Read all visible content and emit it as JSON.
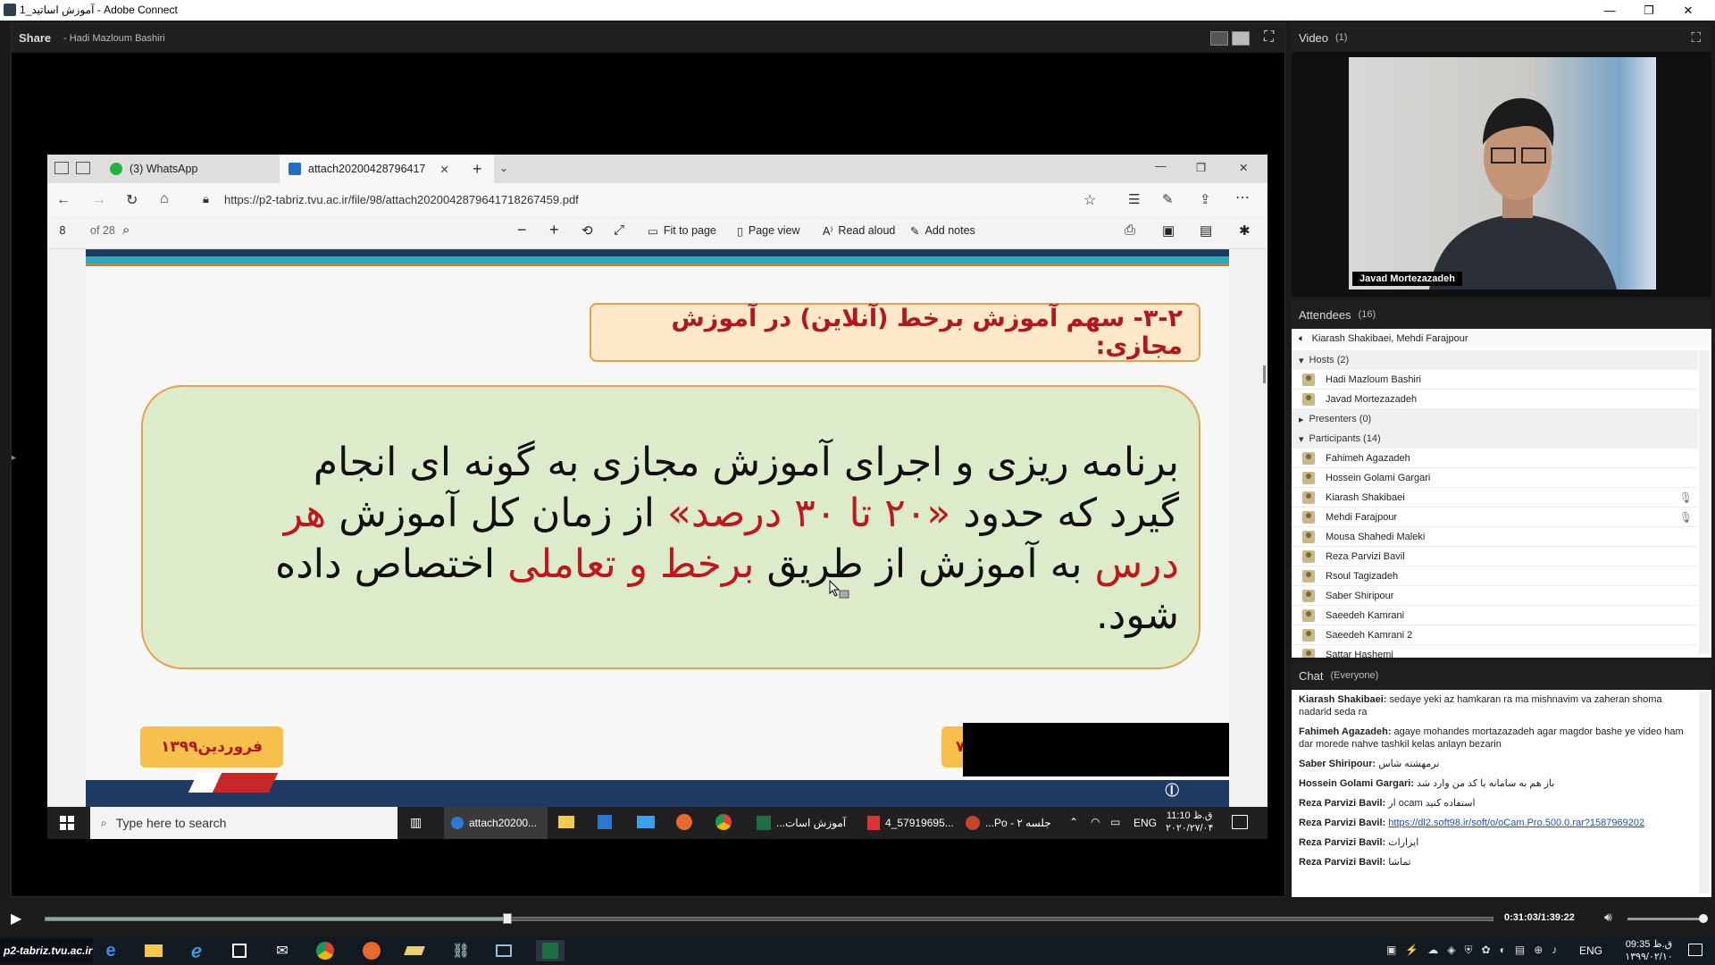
{
  "window": {
    "title": "آموزش اساتید_1 - Adobe Connect"
  },
  "share_pod": {
    "label": "Share",
    "presenter": "- Hadi Mazloum Bashiri"
  },
  "browser": {
    "tabs": [
      {
        "label": "(3) WhatsApp"
      },
      {
        "label": "attach20200428796417"
      }
    ],
    "url": "https://p2-tabriz.tvu.ac.ir/file/98/attach202004287964171826745​9.pdf",
    "pdf_toolbar": {
      "page_number": "8",
      "page_total": "of 28",
      "fit_to_page": "Fit to page",
      "page_view": "Page view",
      "read_aloud": "Read aloud",
      "add_notes": "Add notes"
    },
    "slide": {
      "heading": "۳-۲- سهم آموزش برخط (آنلاین) در آموزش مجازی:",
      "body_lines": [
        [
          {
            "t": "برنامه ریزی و اجرای آموزش مجازی به گونه ای انجام",
            "c": "#111"
          }
        ],
        [
          {
            "t": "گیرد که حدود ",
            "c": "#111"
          },
          {
            "t": "«۲۰ تا ۳۰ درصد»",
            "c": "#c0161c"
          },
          {
            "t": " از زمان کل آموزش ",
            "c": "#111"
          },
          {
            "t": "هر",
            "c": "#c0161c"
          }
        ],
        [
          {
            "t": "درس",
            "c": "#c0161c"
          },
          {
            "t": " به آموزش از طریق ",
            "c": "#111"
          },
          {
            "t": "برخط و تعاملی",
            "c": "#c0161c"
          },
          {
            "t": " اختصاص داده",
            "c": "#111"
          }
        ],
        [
          {
            "t": "شود.",
            "c": "#111"
          }
        ]
      ],
      "date_badge": "فروردین۱۳۹۹",
      "right_badge_char": "۷"
    },
    "taskbar": {
      "search_placeholder": "Type here to search",
      "items": [
        "attach20200...",
        "آموزش اسات...",
        "4_57919695...",
        "جلسه ۲ - Po..."
      ],
      "lang": "ENG",
      "time": "11:10 ق.ظ",
      "date": "۲۰۲۰/۲۷/۰۴"
    }
  },
  "video_pod": {
    "title": "Video",
    "count": "(1)",
    "name_tag": "Javad Mortezazadeh"
  },
  "attendees": {
    "title": "Attendees",
    "count": "(16)",
    "top_line": "Kiarash Shakibaei, Mehdi Farajpour",
    "hosts_label": "Hosts (2)",
    "hosts": [
      "Hadi Mazloum Bashiri",
      "Javad Mortezazadeh"
    ],
    "presenters_label": "Presenters (0)",
    "participants_label": "Participants (14)",
    "participants": [
      "Fahimeh Agazadeh",
      "Hossein Golami Gargari",
      "Kiarash Shakibaei",
      "Mehdi Farajpour",
      "Mousa Shahedi Maleki",
      "Reza Parvizi Bavil",
      "Rsoul Tagizadeh",
      "Saber Shiripour",
      "Saeedeh Kamrani",
      "Saeedeh Kamrani 2",
      "Sattar Hashemi"
    ]
  },
  "chat": {
    "title": "Chat",
    "scope": "(Everyone)",
    "messages": [
      {
        "from": "Kiarash Shakibaei:",
        "text": " sedaye yeki az hamkaran ra ma mishnavim va zaheran shoma nadarid seda ra"
      },
      {
        "from": "Fahimeh Agazadeh:",
        "text": " agaye mohandes mortazazadeh agar magdor bashe ye video ham dar morede nahve tashkil kelas anlayn bezarin"
      },
      {
        "from": "Saber Shiripour:",
        "text": " نرمهشته شاس"
      },
      {
        "from": "Hossein Golami Gargari:",
        "text": " باز هم به سامانه یا کد من وارد شد"
      },
      {
        "from": "Reza Parvizi Bavil:",
        "text": " از ocam استفاده کنید"
      },
      {
        "from": "Reza Parvizi Bavil:",
        "text": "",
        "link": "https://dl2.soft98.ir/soft/o/oCam.Pro.500.0.rar?1587969202"
      },
      {
        "from": "Reza Parvizi Bavil:",
        "text": " ایزارات"
      },
      {
        "from": "Reza Parvizi Bavil:",
        "text": " تماشا"
      }
    ]
  },
  "playback": {
    "time": "0:31:03/1:39:22",
    "progress_fraction": 0.319
  },
  "os_taskbar": {
    "brand": "p2-tabriz.tvu.ac.ir",
    "lang": "ENG",
    "time": "09:35 ق.ظ",
    "date": "۱۳۹۹/۰۲/۱۰"
  }
}
